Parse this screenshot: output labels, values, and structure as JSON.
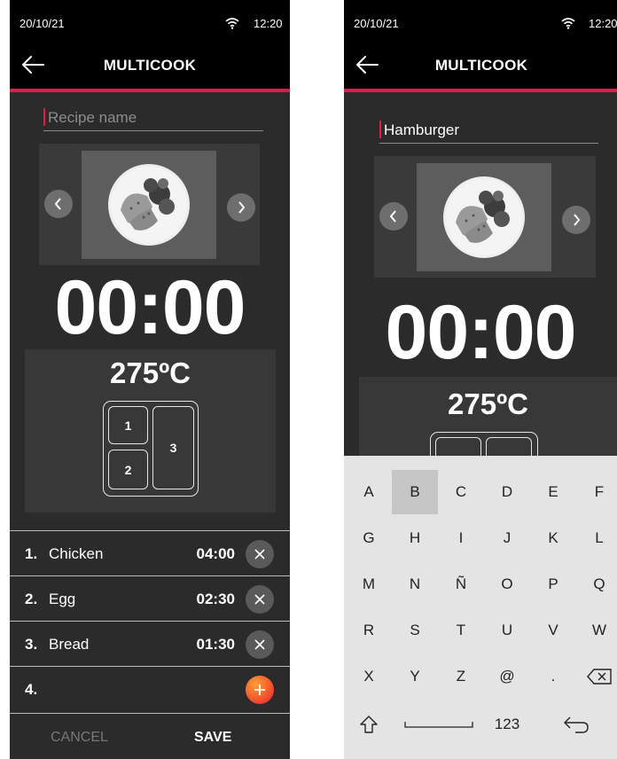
{
  "colors": {
    "accent": "#e8174c",
    "background": "#2b2b2b",
    "bar": "#000000",
    "keyboard": "#e4e4e4"
  },
  "left_screen": {
    "status": {
      "date": "20/10/21",
      "time": "12:20",
      "icon": "wifi-icon"
    },
    "title": "MULTICOOK",
    "recipe_name": {
      "value": "",
      "placeholder": "Recipe name"
    },
    "timer": "00:00",
    "temperature": "275ºC",
    "slots": [
      "1",
      "2",
      "3"
    ],
    "steps": [
      {
        "num": "1.",
        "name": "Chicken",
        "time": "04:00"
      },
      {
        "num": "2.",
        "name": "Egg",
        "time": "02:30"
      },
      {
        "num": "3.",
        "name": "Bread",
        "time": "01:30"
      },
      {
        "num": "4.",
        "name": "",
        "time": ""
      }
    ],
    "cancel_label": "CANCEL",
    "save_label": "SAVE"
  },
  "right_screen": {
    "status": {
      "date": "20/10/21",
      "time": "12:20",
      "icon": "wifi-icon"
    },
    "title": "MULTICOOK",
    "recipe_name": {
      "value": "Hamburger",
      "placeholder": "Recipe name"
    },
    "timer": "00:00",
    "temperature": "275ºC",
    "keyboard": {
      "rows": [
        [
          "A",
          "B",
          "C",
          "D",
          "E",
          "F"
        ],
        [
          "G",
          "H",
          "I",
          "J",
          "K",
          "L"
        ],
        [
          "M",
          "N",
          "Ñ",
          "O",
          "P",
          "Q"
        ],
        [
          "R",
          "S",
          "T",
          "U",
          "V",
          "W"
        ],
        [
          "X",
          "Y",
          "Z",
          "@",
          ".",
          "⌫"
        ],
        [
          "⇧",
          "space",
          "123",
          "↵"
        ]
      ],
      "pressed_key": "B",
      "numbers_label": "123"
    }
  }
}
